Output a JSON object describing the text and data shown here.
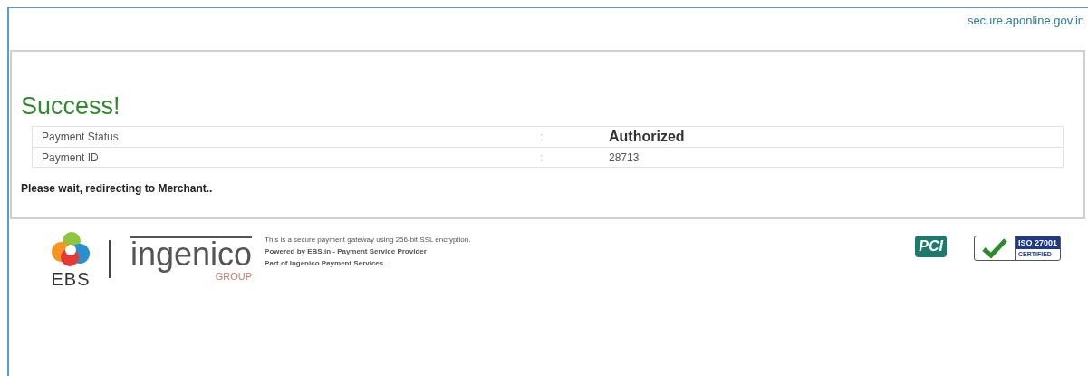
{
  "header": {
    "domain": "secure.aponline.gov.in"
  },
  "result": {
    "title": "Success!",
    "rows": [
      {
        "label": "Payment Status",
        "separator": ":",
        "value": "Authorized",
        "emphasis": true
      },
      {
        "label": "Payment ID",
        "separator": ":",
        "value": "28713",
        "emphasis": false
      }
    ],
    "message": "Please wait, redirecting to Merchant.."
  },
  "footer": {
    "ebs_logo": "EBS",
    "ingenico_logo": "ingenico",
    "ingenico_sub": "GROUP",
    "lines": [
      "This is a secure payment gateway using 256-bit SSL encryption.",
      "Powered by EBS.in - Payment Service Provider",
      "Part of Ingenico Payment Services."
    ],
    "pci_logo": "PCI",
    "iso_title": "ISO 27001",
    "iso_sub": "CERTIFIED"
  }
}
